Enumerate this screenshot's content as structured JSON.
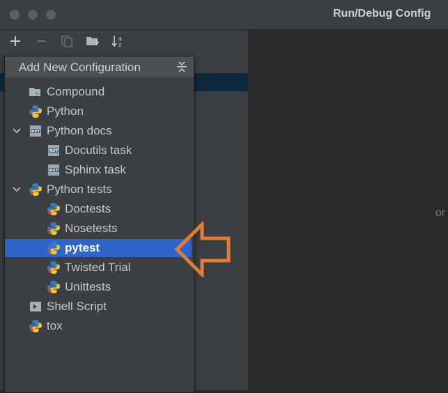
{
  "window": {
    "title": "Run/Debug Config"
  },
  "toolbar": {
    "add_icon": "plus-icon",
    "remove_icon": "minus-icon",
    "copy_icon": "copy-icon",
    "folder_icon": "new-folder-icon",
    "sort_icon": "sort-alpha-icon"
  },
  "right_panel": {
    "hint": "or"
  },
  "popup": {
    "title": "Add New Configuration",
    "items": [
      {
        "label": "Compound",
        "icon": "compound-icon",
        "level": 0,
        "expandable": false
      },
      {
        "label": "Python",
        "icon": "python-icon",
        "level": 0,
        "expandable": false
      },
      {
        "label": "Python docs",
        "icon": "rst-icon",
        "level": 0,
        "expandable": true,
        "expanded": true
      },
      {
        "label": "Docutils task",
        "icon": "rst-icon",
        "level": 1,
        "expandable": false
      },
      {
        "label": "Sphinx task",
        "icon": "rst-icon",
        "level": 1,
        "expandable": false
      },
      {
        "label": "Python tests",
        "icon": "python-tests-icon",
        "level": 0,
        "expandable": true,
        "expanded": true
      },
      {
        "label": "Doctests",
        "icon": "python-tests-icon",
        "level": 1,
        "expandable": false
      },
      {
        "label": "Nosetests",
        "icon": "python-tests-icon",
        "level": 1,
        "expandable": false
      },
      {
        "label": "pytest",
        "icon": "python-tests-icon",
        "level": 1,
        "expandable": false,
        "selected": true
      },
      {
        "label": "Twisted Trial",
        "icon": "python-tests-icon",
        "level": 1,
        "expandable": false
      },
      {
        "label": "Unittests",
        "icon": "python-tests-icon",
        "level": 1,
        "expandable": false
      },
      {
        "label": "Shell Script",
        "icon": "shell-script-icon",
        "level": 0,
        "expandable": false
      },
      {
        "label": "tox",
        "icon": "python-tests-icon",
        "level": 0,
        "expandable": false
      }
    ]
  },
  "colors": {
    "selection": "#2f65ca",
    "annotation_arrow": "#e07b39"
  }
}
